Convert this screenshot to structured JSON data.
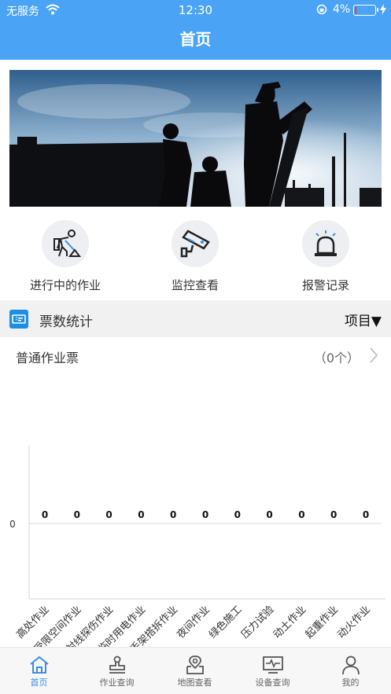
{
  "status": {
    "carrier": "无服务",
    "time": "12:30",
    "battery": "4%",
    "battery_level": 0.04
  },
  "nav": {
    "title": "首页"
  },
  "quick_actions": [
    {
      "label": "进行中的作业",
      "icon": "worker-icon"
    },
    {
      "label": "监控查看",
      "icon": "cctv-camera-icon"
    },
    {
      "label": "报警记录",
      "icon": "alarm-light-icon"
    }
  ],
  "section": {
    "title": "票数统计",
    "project": "项目▼"
  },
  "ticket": {
    "name": "普通作业票",
    "count": "（0个）"
  },
  "chart_data": {
    "type": "bar",
    "categories": [
      "高处作业",
      "受限空间作业",
      "射线探伤作业",
      "临时用电作业",
      "脚手架搭拆作业",
      "夜间作业",
      "绿色施工",
      "压力试验",
      "动土作业",
      "起重作业",
      "动火作业"
    ],
    "values": [
      0,
      0,
      0,
      0,
      0,
      0,
      0,
      0,
      0,
      0,
      0
    ],
    "ytick_labels": [
      "0"
    ],
    "data_labels": [
      "0",
      "0",
      "0",
      "0",
      "0",
      "0",
      "0",
      "0",
      "0",
      "0",
      "0"
    ]
  },
  "tabs": [
    {
      "label": "首页",
      "icon": "home-icon",
      "active": true
    },
    {
      "label": "作业查询",
      "icon": "stamp-icon",
      "active": false
    },
    {
      "label": "地图查看",
      "icon": "map-pin-icon",
      "active": false
    },
    {
      "label": "设备查询",
      "icon": "monitor-icon",
      "active": false
    },
    {
      "label": "我的",
      "icon": "user-icon",
      "active": false
    }
  ],
  "colors": {
    "primary": "#4aa3f5",
    "active_tab": "#3a8ee6",
    "ticket_icon": "#1e8fe6"
  }
}
